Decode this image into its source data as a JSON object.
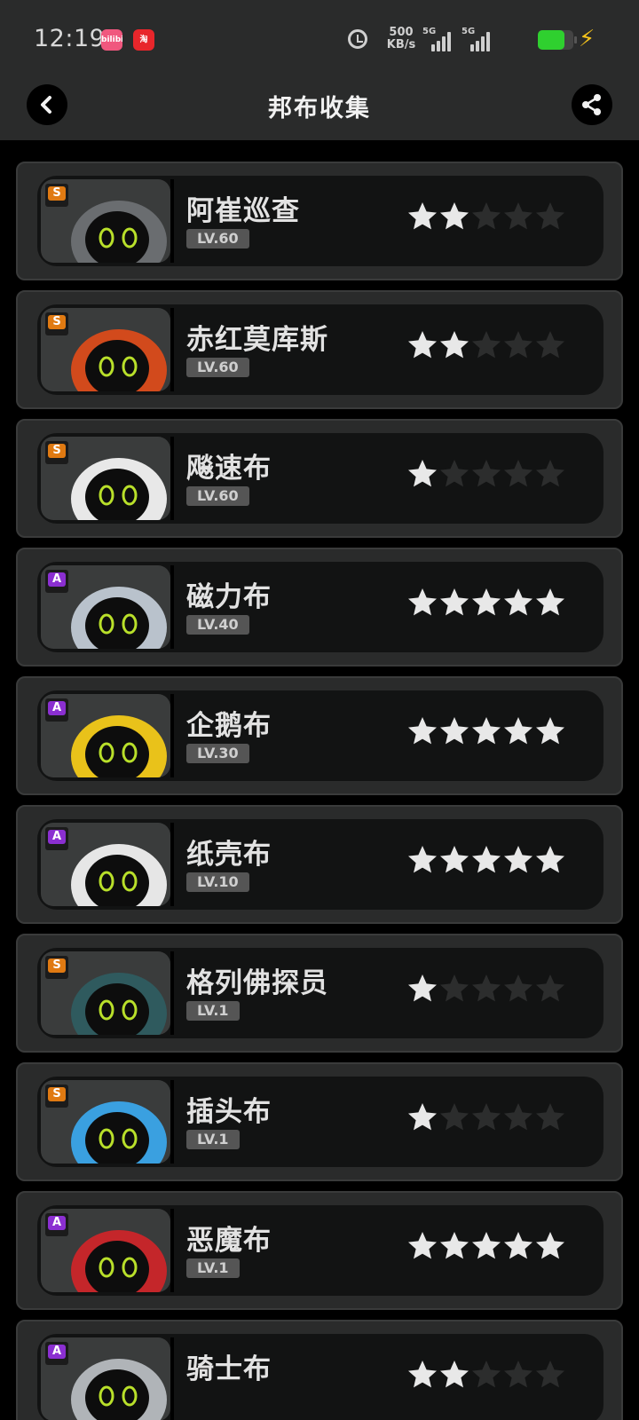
{
  "status_bar": {
    "time": "12:19",
    "app_badge_1": "bilibili",
    "app_badge_2": "淘",
    "net_speed": "500",
    "net_unit": "KB/s",
    "signal_1": "5G",
    "signal_2": "5G",
    "battery_level": 0.8
  },
  "nav": {
    "title": "邦布收集",
    "back_icon": "chevron-left-icon",
    "share_icon": "share-icon"
  },
  "colors": {
    "rank_s": "#e07a12",
    "rank_a": "#8b2fd1",
    "star_on": "#e8e8e8",
    "star_off": "#2c2d2d"
  },
  "bangboo": [
    {
      "name": "阿崔巡查",
      "level": "LV.60",
      "rank": "S",
      "stars": 2,
      "portrait": "bangboo-rabbit-portrait"
    },
    {
      "name": "赤红莫库斯",
      "level": "LV.60",
      "rank": "S",
      "stars": 2,
      "portrait": "bangboo-red-pig-portrait"
    },
    {
      "name": "飚速布",
      "level": "LV.60",
      "rank": "S",
      "stars": 1,
      "portrait": "bangboo-goggles-portrait"
    },
    {
      "name": "磁力布",
      "level": "LV.40",
      "rank": "A",
      "stars": 5,
      "portrait": "bangboo-magnet-portrait"
    },
    {
      "name": "企鹅布",
      "level": "LV.30",
      "rank": "A",
      "stars": 5,
      "portrait": "bangboo-penguin-portrait"
    },
    {
      "name": "纸壳布",
      "level": "LV.10",
      "rank": "A",
      "stars": 5,
      "portrait": "bangboo-cardboard-portrait"
    },
    {
      "name": "格列佛探员",
      "level": "LV.1",
      "rank": "S",
      "stars": 1,
      "portrait": "bangboo-detective-portrait"
    },
    {
      "name": "插头布",
      "level": "LV.1",
      "rank": "S",
      "stars": 1,
      "portrait": "bangboo-plug-portrait"
    },
    {
      "name": "恶魔布",
      "level": "LV.1",
      "rank": "A",
      "stars": 5,
      "portrait": "bangboo-devil-portrait"
    },
    {
      "name": "骑士布",
      "level": "",
      "rank": "A",
      "stars": 2,
      "portrait": "bangboo-knight-portrait"
    }
  ]
}
